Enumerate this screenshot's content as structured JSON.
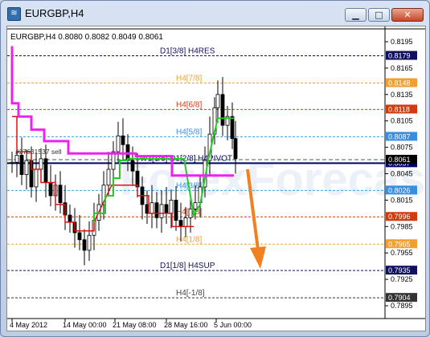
{
  "window": {
    "title": "EURGBP,H4",
    "buttons": {
      "minimize": "▁",
      "maximize": "□",
      "close": "✕"
    }
  },
  "chart_data": {
    "type": "candlestick",
    "info_line": "EURGBP,H4  0.8080 0.8082 0.8049 0.8061",
    "ylim": [
      0.7885,
      0.8205
    ],
    "y_ticks": [
      "0.8195",
      "0.8165",
      "0.8135",
      "0.8105",
      "0.8075",
      "0.8045",
      "0.8015",
      "0.7985",
      "0.7955",
      "0.7925",
      "0.7895"
    ],
    "x_ticks": [
      "4 May 2012",
      "14 May 00:00",
      "21 May 08:00",
      "28 May 16:00",
      "5 Jun 00:00"
    ],
    "current_price_label": "0.8061",
    "levels": [
      {
        "name": "D1[3/8] H4RES",
        "price": "0.8179",
        "line_color": "#101060",
        "label_color": "#101060",
        "tag_bg": "#101060"
      },
      {
        "name": "H4[7/8]",
        "price": "0.8148",
        "line_color": "#f0a030",
        "label_color": "#f0a030",
        "tag_bg": "#f0a030"
      },
      {
        "name": "H4[6/8]",
        "price": "0.8118",
        "line_color": "#d23a10",
        "label_color": "#d23a10",
        "tag_bg": "#d23a10"
      },
      {
        "name": "H4[5/8]",
        "price": "0.8087",
        "line_color": "#3aa0e8",
        "label_color": "#3a8ee0",
        "tag_bg": "#3a8ee0"
      },
      {
        "name": "W1[1/8] D1[2/8] H4PIVOT",
        "price": "0.8057",
        "line_color": "#000066",
        "label_color": "#000066",
        "tag_bg": "#000066"
      },
      {
        "name": "H4[3/8]",
        "price": "0.8026",
        "line_color": "#3aa0e8",
        "label_color": "#3a8ee0",
        "tag_bg": "#3a8ee0"
      },
      {
        "name": "H4[2/8]",
        "price": "0.7996",
        "line_color": "#d23a10",
        "label_color": "#d23a10",
        "tag_bg": "#d23a10"
      },
      {
        "name": "H4[1/8]",
        "price": "0.7965",
        "line_color": "#f0a030",
        "label_color": "#f0a030",
        "tag_bg": "#f0a030"
      },
      {
        "name": "D1[1/8] H4SUP",
        "price": "0.7935",
        "line_color": "#101060",
        "label_color": "#101060",
        "tag_bg": "#101060"
      },
      {
        "name": "H4[-1/8]",
        "price": "0.7904",
        "line_color": "#333333",
        "label_color": "#444444",
        "tag_bg": "#333333"
      }
    ],
    "order_label": "#27631537 sell",
    "watermark": "ForexForecast",
    "colors": {
      "magenta": "#ee22ee",
      "green": "#22cc22",
      "red": "#dd1111",
      "arrow": "#f08020"
    }
  }
}
